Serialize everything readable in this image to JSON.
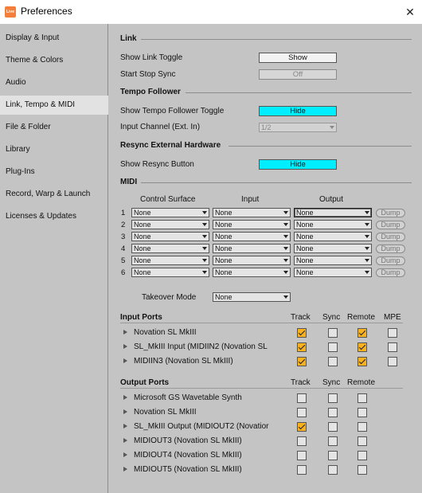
{
  "window": {
    "app_icon_text": "Live",
    "title": "Preferences",
    "close_glyph": "✕"
  },
  "sidebar": {
    "items": [
      {
        "label": "Display & Input",
        "active": false
      },
      {
        "label": "Theme & Colors",
        "active": false
      },
      {
        "label": "Audio",
        "active": false
      },
      {
        "label": "Link, Tempo & MIDI",
        "active": true
      },
      {
        "label": "File & Folder",
        "active": false
      },
      {
        "label": "Library",
        "active": false
      },
      {
        "label": "Plug-Ins",
        "active": false
      },
      {
        "label": "Record, Warp & Launch",
        "active": false
      },
      {
        "label": "Licenses & Updates",
        "active": false
      }
    ]
  },
  "link": {
    "heading": "Link",
    "show_link_toggle_label": "Show Link Toggle",
    "show_link_toggle_value": "Show",
    "start_stop_sync_label": "Start Stop Sync",
    "start_stop_sync_value": "Off"
  },
  "tempo_follower": {
    "heading": "Tempo Follower",
    "toggle_label": "Show Tempo Follower Toggle",
    "toggle_value": "Hide",
    "input_channel_label": "Input Channel (Ext. In)",
    "input_channel_value": "1/2"
  },
  "resync": {
    "heading": "Resync External Hardware",
    "button_label": "Show Resync Button",
    "button_value": "Hide"
  },
  "midi": {
    "heading": "MIDI",
    "col_control_surface": "Control Surface",
    "col_input": "Input",
    "col_output": "Output",
    "rows": [
      {
        "num": "1",
        "surface": "None",
        "input": "None",
        "output": "None",
        "dump": "Dump"
      },
      {
        "num": "2",
        "surface": "None",
        "input": "None",
        "output": "None",
        "dump": "Dump"
      },
      {
        "num": "3",
        "surface": "None",
        "input": "None",
        "output": "None",
        "dump": "Dump"
      },
      {
        "num": "4",
        "surface": "None",
        "input": "None",
        "output": "None",
        "dump": "Dump"
      },
      {
        "num": "5",
        "surface": "None",
        "input": "None",
        "output": "None",
        "dump": "Dump"
      },
      {
        "num": "6",
        "surface": "None",
        "input": "None",
        "output": "None",
        "dump": "Dump"
      }
    ],
    "takeover_label": "Takeover Mode",
    "takeover_value": "None"
  },
  "input_ports": {
    "heading": "Input Ports",
    "col_track": "Track",
    "col_sync": "Sync",
    "col_remote": "Remote",
    "col_mpe": "MPE",
    "rows": [
      {
        "name": "Novation SL MkIII",
        "track": true,
        "sync": false,
        "remote": true,
        "mpe": false
      },
      {
        "name": "SL_MkIII Input (MIDIIN2 (Novation SL",
        "track": true,
        "sync": false,
        "remote": true,
        "mpe": false
      },
      {
        "name": "MIDIIN3 (Novation SL MkIII)",
        "track": true,
        "sync": false,
        "remote": true,
        "mpe": false
      }
    ]
  },
  "output_ports": {
    "heading": "Output Ports",
    "col_track": "Track",
    "col_sync": "Sync",
    "col_remote": "Remote",
    "rows": [
      {
        "name": "Microsoft GS Wavetable Synth",
        "track": false,
        "sync": false,
        "remote": false
      },
      {
        "name": "Novation SL MkIII",
        "track": false,
        "sync": false,
        "remote": false
      },
      {
        "name": "SL_MkIII Output (MIDIOUT2 (Novatior",
        "track": true,
        "sync": false,
        "remote": false
      },
      {
        "name": "MIDIOUT3 (Novation SL MkIII)",
        "track": false,
        "sync": false,
        "remote": false
      },
      {
        "name": "MIDIOUT4 (Novation SL MkIII)",
        "track": false,
        "sync": false,
        "remote": false
      },
      {
        "name": "MIDIOUT5 (Novation SL MkIII)",
        "track": false,
        "sync": false,
        "remote": false
      }
    ]
  }
}
